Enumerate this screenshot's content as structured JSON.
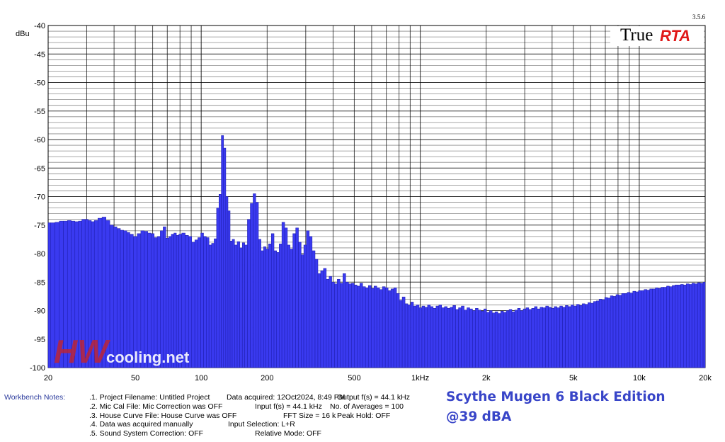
{
  "version": "3.5.6",
  "brand": {
    "part1": "True",
    "part2": "RTA"
  },
  "watermark": {
    "part1": "HW",
    "part2": "cooling.net"
  },
  "caption": {
    "line1": "Scythe Mugen 6 Black Edition",
    "line2": "@39 dBA"
  },
  "notes": {
    "label": "Workbench Notes:",
    "col1": [
      ".1. Project Filename: Untitled Project",
      ".2. Mic Cal File: Mic Correction was OFF",
      ".3. House Curve File: House Curve was OFF",
      ".4. Data was acquired manually",
      ".5. Sound System Correction: OFF"
    ],
    "col2": [
      "Data acquired: 12Oct2024, 8:49 PM",
      "Input f(s) = 44.1 kHz",
      "FFT Size = 16 k",
      "Input Selection: L+R",
      "Relative Mode:  OFF"
    ],
    "col3": [
      "",
      "Output f(s) = 44.1 kHz",
      "",
      "No. of Averages = 100",
      "Peak Hold: OFF"
    ]
  },
  "colors": {
    "bar": "#3a3af0",
    "bar_edge": "#1c1ca8",
    "grid": "#000000",
    "caption": "#3845c8",
    "brand_red": "#e01818"
  },
  "chart_data": {
    "type": "bar",
    "ylabel": "dBu",
    "xscale": "log",
    "xlim": [
      20,
      20000
    ],
    "ylim": [
      -100,
      -40
    ],
    "grid": true,
    "xticks": [
      {
        "value": 20,
        "label": "20"
      },
      {
        "value": 50,
        "label": "50"
      },
      {
        "value": 100,
        "label": "100"
      },
      {
        "value": 200,
        "label": "200"
      },
      {
        "value": 500,
        "label": "500"
      },
      {
        "value": 1000,
        "label": "1kHz"
      },
      {
        "value": 2000,
        "label": "2k"
      },
      {
        "value": 5000,
        "label": "5k"
      },
      {
        "value": 10000,
        "label": "10k"
      },
      {
        "value": 20000,
        "label": "20k"
      }
    ],
    "yticks": [
      {
        "value": -40,
        "label": "-40"
      },
      {
        "value": -45,
        "label": "-45"
      },
      {
        "value": -50,
        "label": "-50"
      },
      {
        "value": -55,
        "label": "-55"
      },
      {
        "value": -60,
        "label": "-60"
      },
      {
        "value": -65,
        "label": "-65"
      },
      {
        "value": -70,
        "label": "-70"
      },
      {
        "value": -75,
        "label": "-75"
      },
      {
        "value": -80,
        "label": "-80"
      },
      {
        "value": -85,
        "label": "-85"
      },
      {
        "value": -90,
        "label": "-90"
      },
      {
        "value": -95,
        "label": "-95"
      },
      {
        "value": -100,
        "label": "-100"
      }
    ],
    "points": [
      [
        20.0,
        -74.6
      ],
      [
        21.0,
        -74.6
      ],
      [
        22.0,
        -74.5
      ],
      [
        23.0,
        -74.3
      ],
      [
        24.0,
        -74.3
      ],
      [
        25.0,
        -74.2
      ],
      [
        26.0,
        -74.3
      ],
      [
        27.0,
        -74.4
      ],
      [
        28.0,
        -74.3
      ],
      [
        29.0,
        -74.0
      ],
      [
        30.0,
        -74.0
      ],
      [
        31.0,
        -74.2
      ],
      [
        32.0,
        -74.4
      ],
      [
        33.0,
        -74.2
      ],
      [
        34.5,
        -73.8
      ],
      [
        36.0,
        -73.6
      ],
      [
        37.5,
        -74.2
      ],
      [
        39.0,
        -75.0
      ],
      [
        40.5,
        -75.3
      ],
      [
        42.0,
        -75.6
      ],
      [
        43.5,
        -75.9
      ],
      [
        45.0,
        -76.0
      ],
      [
        46.5,
        -76.3
      ],
      [
        48.0,
        -76.6
      ],
      [
        50.0,
        -77.0
      ],
      [
        52.0,
        -76.5
      ],
      [
        54.0,
        -76.0
      ],
      [
        56.0,
        -76.1
      ],
      [
        58.0,
        -76.4
      ],
      [
        60.0,
        -76.5
      ],
      [
        62.0,
        -77.2
      ],
      [
        64.0,
        -77.0
      ],
      [
        66.0,
        -76.0
      ],
      [
        68.0,
        -75.3
      ],
      [
        70.0,
        -77.3
      ],
      [
        72.0,
        -77.0
      ],
      [
        74.0,
        -76.6
      ],
      [
        76.0,
        -76.4
      ],
      [
        78.0,
        -76.8
      ],
      [
        80.0,
        -76.6
      ],
      [
        83.0,
        -76.4
      ],
      [
        86.0,
        -76.8
      ],
      [
        89.0,
        -77.0
      ],
      [
        92.0,
        -78.0
      ],
      [
        95.0,
        -77.6
      ],
      [
        98.0,
        -77.2
      ],
      [
        101.0,
        -76.4
      ],
      [
        104.0,
        -77.0
      ],
      [
        107.0,
        -77.2
      ],
      [
        110.0,
        -78.5
      ],
      [
        113.0,
        -78.2
      ],
      [
        116.0,
        -77.4
      ],
      [
        119.0,
        -72.0
      ],
      [
        122.0,
        -69.6
      ],
      [
        125.0,
        -59.3
      ],
      [
        128.0,
        -61.5
      ],
      [
        131.0,
        -70.0
      ],
      [
        134.0,
        -72.5
      ],
      [
        137.0,
        -77.8
      ],
      [
        140.0,
        -77.5
      ],
      [
        144.0,
        -78.5
      ],
      [
        148.0,
        -77.9
      ],
      [
        152.0,
        -79.0
      ],
      [
        156.0,
        -78.1
      ],
      [
        160.0,
        -78.5
      ],
      [
        165.0,
        -74.0
      ],
      [
        170.0,
        -71.2
      ],
      [
        175.0,
        -69.5
      ],
      [
        180.0,
        -71.0
      ],
      [
        185.0,
        -77.5
      ],
      [
        190.0,
        -79.5
      ],
      [
        195.0,
        -78.8
      ],
      [
        200.0,
        -79.2
      ],
      [
        206.0,
        -78.3
      ],
      [
        212.0,
        -76.5
      ],
      [
        218.0,
        -79.5
      ],
      [
        224.0,
        -79.8
      ],
      [
        230.0,
        -78.3
      ],
      [
        237.0,
        -74.5
      ],
      [
        244.0,
        -75.5
      ],
      [
        251.0,
        -78.5
      ],
      [
        258.0,
        -79.2
      ],
      [
        266.0,
        -76.5
      ],
      [
        274.0,
        -75.5
      ],
      [
        282.0,
        -78.0
      ],
      [
        290.0,
        -80.2
      ],
      [
        298.0,
        -78.5
      ],
      [
        307.0,
        -76.0
      ],
      [
        316.0,
        -77.0
      ],
      [
        326.0,
        -79.5
      ],
      [
        336.0,
        -81.0
      ],
      [
        346.0,
        -83.5
      ],
      [
        356.0,
        -83.0
      ],
      [
        367.0,
        -82.6
      ],
      [
        378.0,
        -84.5
      ],
      [
        389.0,
        -84.0
      ],
      [
        400.0,
        -85.0
      ],
      [
        412.0,
        -85.3
      ],
      [
        424.0,
        -84.5
      ],
      [
        437.0,
        -85.2
      ],
      [
        450.0,
        -83.5
      ],
      [
        464.0,
        -85.0
      ],
      [
        478.0,
        -85.3
      ],
      [
        492.0,
        -85.2
      ],
      [
        507.0,
        -85.5
      ],
      [
        522.0,
        -85.7
      ],
      [
        538.0,
        -85.2
      ],
      [
        554.0,
        -85.8
      ],
      [
        571.0,
        -86.0
      ],
      [
        588.0,
        -85.6
      ],
      [
        606.0,
        -86.1
      ],
      [
        624.0,
        -85.7
      ],
      [
        643.0,
        -86.0
      ],
      [
        662.0,
        -86.3
      ],
      [
        682.0,
        -85.8
      ],
      [
        703.0,
        -86.0
      ],
      [
        724.0,
        -86.5
      ],
      [
        746.0,
        -86.2
      ],
      [
        768.0,
        -86.0
      ],
      [
        791.0,
        -87.0
      ],
      [
        815.0,
        -88.2
      ],
      [
        840.0,
        -87.6
      ],
      [
        865.0,
        -88.8
      ],
      [
        891.0,
        -89.0
      ],
      [
        918.0,
        -88.5
      ],
      [
        945.0,
        -89.2
      ],
      [
        974.0,
        -89.0
      ],
      [
        1003.0,
        -89.5
      ],
      [
        1033.0,
        -89.2
      ],
      [
        1064.0,
        -89.4
      ],
      [
        1096.0,
        -89.0
      ],
      [
        1129.0,
        -89.3
      ],
      [
        1163.0,
        -89.6
      ],
      [
        1198.0,
        -89.2
      ],
      [
        1234.0,
        -89.0
      ],
      [
        1271.0,
        -89.5
      ],
      [
        1309.0,
        -89.3
      ],
      [
        1348.0,
        -89.6
      ],
      [
        1389.0,
        -89.4
      ],
      [
        1430.0,
        -89.1
      ],
      [
        1473.0,
        -89.8
      ],
      [
        1517.0,
        -89.5
      ],
      [
        1563.0,
        -89.2
      ],
      [
        1610.0,
        -89.9
      ],
      [
        1658.0,
        -89.5
      ],
      [
        1708.0,
        -89.7
      ],
      [
        1759.0,
        -90.0
      ],
      [
        1812.0,
        -89.6
      ],
      [
        1866.0,
        -89.9
      ],
      [
        1922.0,
        -90.1
      ],
      [
        1980.0,
        -89.7
      ],
      [
        2039.0,
        -90.3
      ],
      [
        2100.0,
        -90.0
      ],
      [
        2163.0,
        -90.4
      ],
      [
        2228.0,
        -90.2
      ],
      [
        2295.0,
        -90.5
      ],
      [
        2364.0,
        -90.1
      ],
      [
        2435.0,
        -90.3
      ],
      [
        2508.0,
        -90.0
      ],
      [
        2583.0,
        -89.8
      ],
      [
        2661.0,
        -90.2
      ],
      [
        2741.0,
        -89.9
      ],
      [
        2823.0,
        -89.6
      ],
      [
        2908.0,
        -90.0
      ],
      [
        2995.0,
        -89.7
      ],
      [
        3085.0,
        -89.5
      ],
      [
        3177.0,
        -89.8
      ],
      [
        3273.0,
        -89.6
      ],
      [
        3371.0,
        -89.3
      ],
      [
        3472.0,
        -89.7
      ],
      [
        3576.0,
        -89.4
      ],
      [
        3683.0,
        -89.5
      ],
      [
        3794.0,
        -89.2
      ],
      [
        3908.0,
        -89.4
      ],
      [
        4025.0,
        -89.6
      ],
      [
        4146.0,
        -89.3
      ],
      [
        4270.0,
        -89.5
      ],
      [
        4398.0,
        -89.2
      ],
      [
        4530.0,
        -89.4
      ],
      [
        4666.0,
        -89.1
      ],
      [
        4806.0,
        -89.3
      ],
      [
        4950.0,
        -89.0
      ],
      [
        5099.0,
        -89.2
      ],
      [
        5252.0,
        -88.9
      ],
      [
        5409.0,
        -89.1
      ],
      [
        5572.0,
        -88.8
      ],
      [
        5739.0,
        -88.9
      ],
      [
        5911.0,
        -88.6
      ],
      [
        6088.0,
        -88.7
      ],
      [
        6271.0,
        -88.4
      ],
      [
        6459.0,
        -88.3
      ],
      [
        6653.0,
        -88.0
      ],
      [
        6852.0,
        -88.1
      ],
      [
        7058.0,
        -87.7
      ],
      [
        7270.0,
        -87.8
      ],
      [
        7488.0,
        -87.4
      ],
      [
        7712.0,
        -87.5
      ],
      [
        7944.0,
        -87.2
      ],
      [
        8182.0,
        -87.3
      ],
      [
        8428.0,
        -87.0
      ],
      [
        8680.0,
        -87.0
      ],
      [
        8941.0,
        -86.8
      ],
      [
        9209.0,
        -86.9
      ],
      [
        9485.0,
        -86.6
      ],
      [
        9770.0,
        -86.7
      ],
      [
        10063.0,
        -86.5
      ],
      [
        10365.0,
        -86.5
      ],
      [
        10676.0,
        -86.3
      ],
      [
        10996.0,
        -86.4
      ],
      [
        11326.0,
        -86.2
      ],
      [
        11666.0,
        -86.2
      ],
      [
        12016.0,
        -86.0
      ],
      [
        12376.0,
        -86.1
      ],
      [
        12747.0,
        -85.9
      ],
      [
        13130.0,
        -85.9
      ],
      [
        13524.0,
        -85.7
      ],
      [
        13929.0,
        -85.8
      ],
      [
        14347.0,
        -85.6
      ],
      [
        14778.0,
        -85.5
      ],
      [
        15221.0,
        -85.5
      ],
      [
        15678.0,
        -85.4
      ],
      [
        16148.0,
        -85.5
      ],
      [
        16632.0,
        -85.3
      ],
      [
        17131.0,
        -85.4
      ],
      [
        17645.0,
        -85.2
      ],
      [
        18175.0,
        -85.3
      ],
      [
        18720.0,
        -85.1
      ],
      [
        19282.0,
        -85.2
      ],
      [
        19860.0,
        -85.0
      ]
    ]
  }
}
